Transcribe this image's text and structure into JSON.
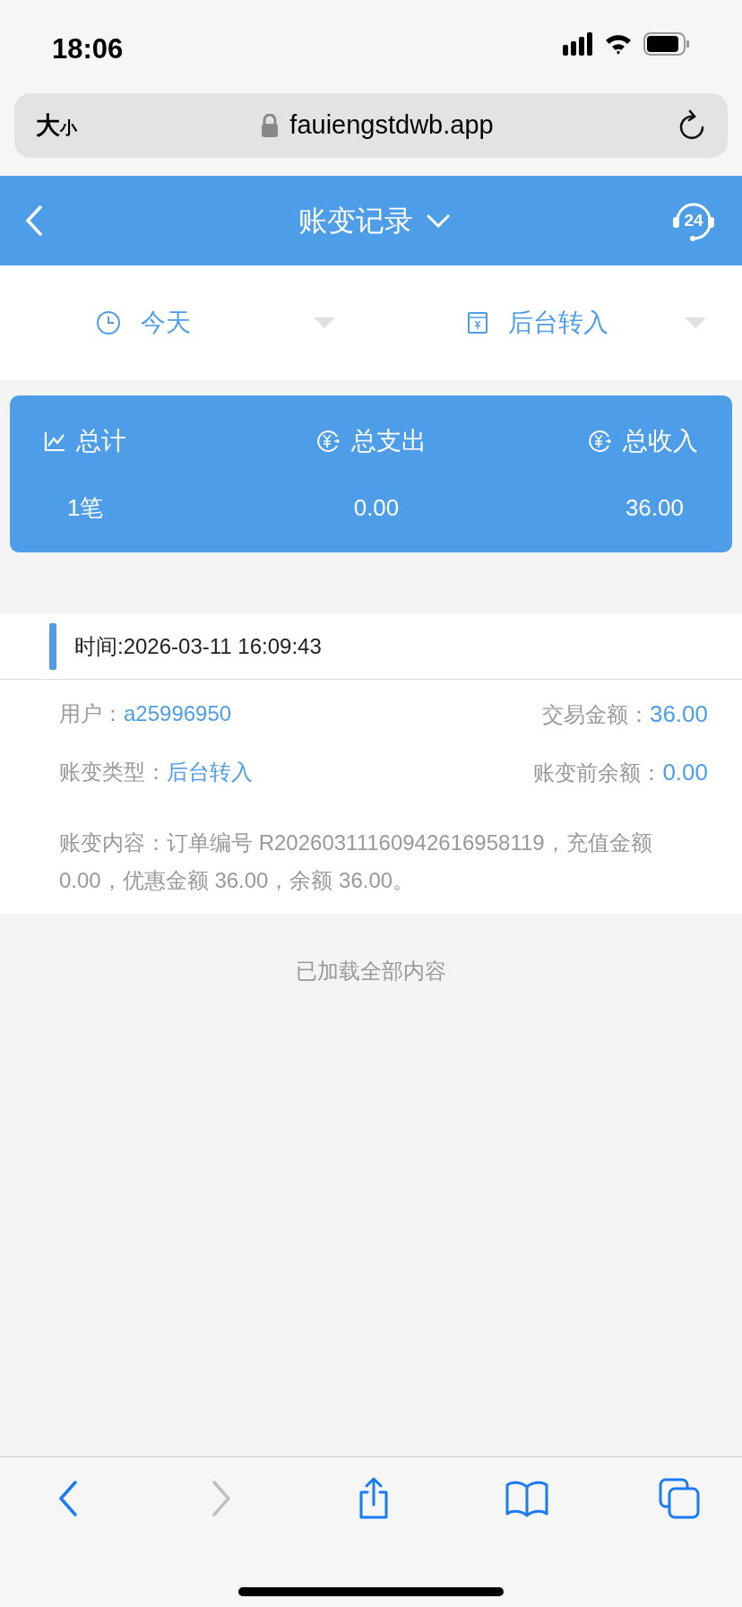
{
  "status_bar": {
    "time": "18:06"
  },
  "browser": {
    "text_size": "大",
    "text_size_small": "小",
    "url": "fauiengstdwb.app"
  },
  "header": {
    "title": "账变记录",
    "support_badge": "24"
  },
  "filters": [
    {
      "kind": "time",
      "label": "今天"
    },
    {
      "kind": "type",
      "label": "后台转入"
    }
  ],
  "summary": [
    {
      "kind": "chart",
      "label": "总计",
      "value": "1笔"
    },
    {
      "kind": "money",
      "label": "总支出",
      "value": "0.00"
    },
    {
      "kind": "money",
      "label": "总收入",
      "value": "36.00"
    }
  ],
  "records": [
    {
      "time": "时间:2026-03-11 16:09:43",
      "user_label": "用户：",
      "user": "a25996950",
      "amount_label": "交易金额：",
      "amount": "36.00",
      "type_label": "账变类型：",
      "type": "后台转入",
      "before_label": "账变前余额：",
      "before": "0.00",
      "content": "账变内容：订单编号 R20260311160942616958119，充值金额 0.00，优惠金额 36.00，余额 36.00。"
    }
  ],
  "footer_note": "已加载全部内容",
  "toolbar": [
    {
      "kind": "back",
      "disabled": false
    },
    {
      "kind": "forward",
      "disabled": true
    },
    {
      "kind": "share",
      "disabled": false
    },
    {
      "kind": "bookmarks",
      "disabled": false
    },
    {
      "kind": "tabs",
      "disabled": false
    }
  ]
}
